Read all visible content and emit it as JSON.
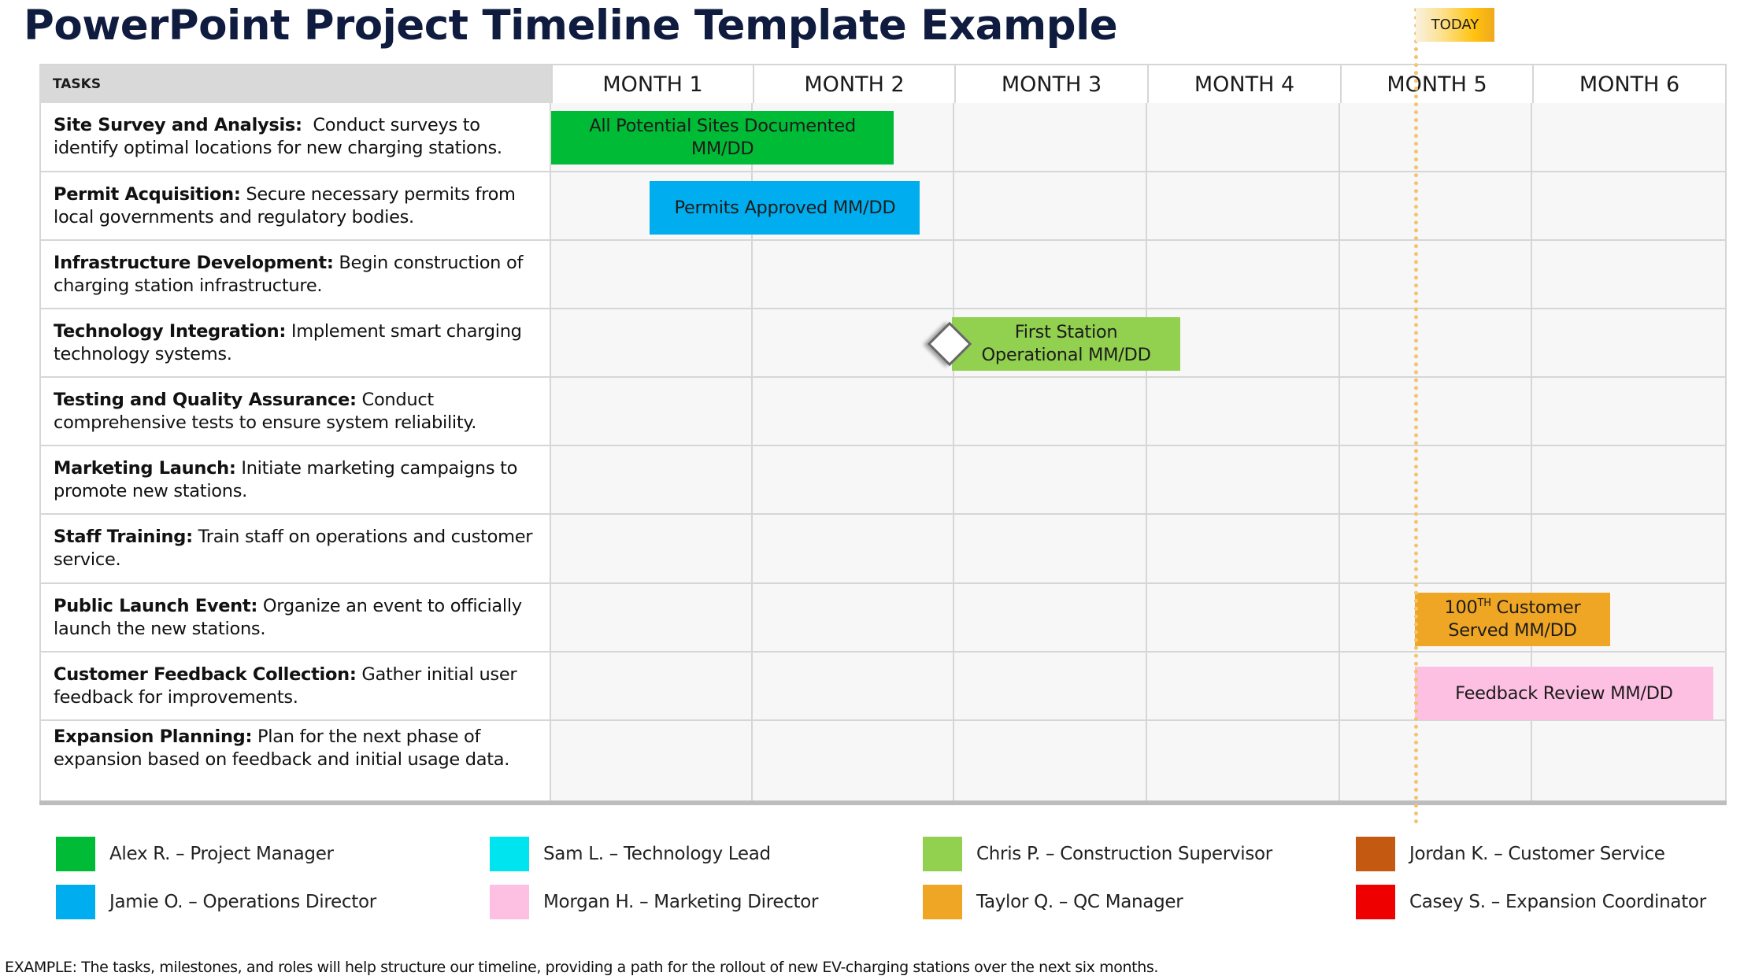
{
  "title": "PowerPoint Project Timeline Template Example",
  "today_label": "TODAY",
  "colors": {
    "alex": "#00bb35",
    "jamie": "#00aeef",
    "sam": "#00e4ef",
    "morgan": "#fdc0e3",
    "chris": "#92d050",
    "taylor": "#f0a625",
    "jordan": "#c45911",
    "casey": "#ee0000",
    "today_line": "#f2c46d"
  },
  "chart_data": {
    "type": "gantt",
    "title": "PowerPoint Project Timeline Template Example",
    "task_column_header": "TASKS",
    "months": [
      "MONTH 1",
      "MONTH 2",
      "MONTH 3",
      "MONTH 4",
      "MONTH 5",
      "MONTH 6"
    ],
    "today_month": 4.39,
    "tasks": [
      {
        "name": "Site Survey and Analysis:",
        "desc": "  Conduct surveys to identify optimal locations for new charging stations."
      },
      {
        "name": "Permit Acquisition:",
        "desc": " Secure necessary permits from local governments and regulatory bodies."
      },
      {
        "name": "Infrastructure Development:",
        "desc": " Begin construction of charging station infrastructure."
      },
      {
        "name": "Technology Integration:",
        "desc": " Implement smart charging technology systems."
      },
      {
        "name": "Testing and Quality Assurance:",
        "desc": " Conduct comprehensive tests to ensure system reliability."
      },
      {
        "name": "Marketing Launch:",
        "desc": " Initiate marketing campaigns to promote new stations."
      },
      {
        "name": "Staff Training:",
        "desc": " Train staff on operations and customer service."
      },
      {
        "name": "Public Launch Event:",
        "desc": " Organize an event to officially launch the new stations."
      },
      {
        "name": "Customer Feedback Collection:",
        "desc": " Gather initial user feedback for improvements."
      },
      {
        "name": "Expansion Planning:",
        "desc": " Plan for the next phase of expansion based on feedback and initial usage data."
      }
    ],
    "bars": [
      {
        "row": 0,
        "start": 0.0,
        "end": 1.7,
        "label": "All Potential Sites Documented MM/DD",
        "owner": "alex",
        "color": "#00bb35"
      },
      {
        "row": 1,
        "start": 0.49,
        "end": 1.83,
        "label": "Permits Approved MM/DD",
        "owner": "jamie",
        "color": "#00aeef"
      },
      {
        "row": 3,
        "start": 1.99,
        "end": 3.17,
        "label": "First Station Operational MM/DD",
        "owner": "chris",
        "color": "#92d050",
        "milestone": true
      },
      {
        "row": 7,
        "start": 4.39,
        "end": 5.4,
        "label_main": "100",
        "label_sup": "TH",
        "label_rest": " Customer Served MM/DD",
        "owner": "taylor",
        "color": "#f0a625"
      },
      {
        "row": 8,
        "start": 4.39,
        "end": 5.93,
        "label": "Feedback Review MM/DD",
        "owner": "morgan",
        "color": "#fdc0e3"
      }
    ]
  },
  "legend": [
    {
      "label": "Alex R. – Project Manager",
      "color": "#00bb35"
    },
    {
      "label": "Jamie O. – Operations Director",
      "color": "#00aeef"
    },
    {
      "label": "Sam L. – Technology Lead",
      "color": "#00e4ef"
    },
    {
      "label": "Morgan H. – Marketing Director",
      "color": "#fdc0e3"
    },
    {
      "label": "Chris P. – Construction Supervisor",
      "color": "#92d050"
    },
    {
      "label": "Taylor Q. – QC Manager",
      "color": "#f0a625"
    },
    {
      "label": "Jordan K. – Customer Service",
      "color": "#c45911"
    },
    {
      "label": "Casey S. – Expansion Coordinator",
      "color": "#ee0000"
    }
  ],
  "footer": "EXAMPLE: The tasks, milestones, and roles will help structure our timeline, providing a path for the rollout of new EV-charging stations over the next six months."
}
